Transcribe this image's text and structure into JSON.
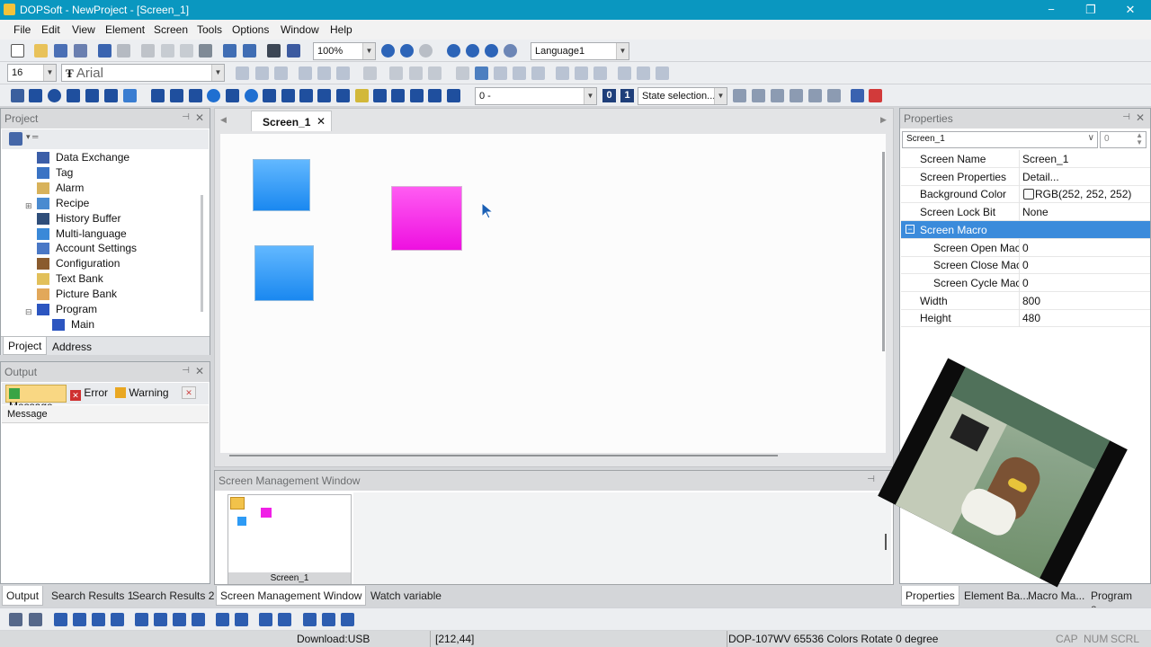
{
  "app": {
    "title": "DOPSoft - NewProject - [Screen_1]"
  },
  "window_controls": {
    "minimize": "−",
    "maximize": "❐",
    "close": "✕"
  },
  "menu": [
    "File",
    "Edit",
    "View",
    "Element",
    "Screen",
    "Tools",
    "Options",
    "Window",
    "Help"
  ],
  "toolbar": {
    "zoom": "100%",
    "language": "Language1",
    "font_size": "16",
    "font_name": "Arial",
    "state_value": "0 -",
    "state_0": "0",
    "state_1": "1",
    "state_selection": "State selection..."
  },
  "project_panel": {
    "title": "Project",
    "items": [
      {
        "label": "Data Exchange",
        "icon": "data-exchange-icon",
        "color": "#3b5ea8"
      },
      {
        "label": "Tag",
        "icon": "tag-icon",
        "color": "#3a73c4"
      },
      {
        "label": "Alarm",
        "icon": "alarm-icon",
        "color": "#d8b25a"
      },
      {
        "label": "Recipe",
        "icon": "recipe-icon",
        "color": "#4a8bd0"
      },
      {
        "label": "History Buffer",
        "icon": "history-buffer-icon",
        "color": "#2f4e7a"
      },
      {
        "label": "Multi-language",
        "icon": "globe-icon",
        "color": "#3a89d8"
      },
      {
        "label": "Account Settings",
        "icon": "account-icon",
        "color": "#4a78c6"
      },
      {
        "label": "Configuration",
        "icon": "configuration-icon",
        "color": "#8a5b2e"
      },
      {
        "label": "Text Bank",
        "icon": "text-bank-icon",
        "color": "#e2c05a"
      },
      {
        "label": "Picture Bank",
        "icon": "picture-bank-icon",
        "color": "#e2a85a"
      },
      {
        "label": "Program",
        "icon": "program-icon",
        "color": "#2c55c0"
      },
      {
        "label": "Main",
        "icon": "main-program-icon",
        "color": "#2c55c0"
      }
    ],
    "tabs": [
      "Project",
      "Address"
    ]
  },
  "output_panel": {
    "title": "Output",
    "filters": [
      "Message",
      "Error",
      "Warning"
    ],
    "column": "Message"
  },
  "document": {
    "tab": "Screen_1"
  },
  "canvas": {
    "shapes": [
      {
        "name": "blue-rect-1",
        "color": "#2e9bf5"
      },
      {
        "name": "blue-rect-2",
        "color": "#2e9bf5"
      },
      {
        "name": "magenta-rect",
        "color": "#f020e6"
      }
    ]
  },
  "screen_mgmt": {
    "title": "Screen Management Window",
    "thumb_label": "Screen_1"
  },
  "bottom_tabs": [
    "Output",
    "Search Results 1",
    "Search Results 2",
    "Screen Management Window",
    "Watch variable"
  ],
  "properties": {
    "title": "Properties",
    "selector": "Screen_1",
    "selector_num": "0",
    "rows": [
      {
        "name": "Screen Name",
        "value": "Screen_1"
      },
      {
        "name": "Screen Properties",
        "value": "Detail..."
      },
      {
        "name": "Background Color",
        "value": "RGB(252, 252, 252)"
      },
      {
        "name": "Screen Lock Bit",
        "value": "None"
      }
    ],
    "group": "Screen Macro",
    "macro_rows": [
      {
        "name": "Screen Open Mac",
        "value": "0"
      },
      {
        "name": "Screen Close Macr",
        "value": "0"
      },
      {
        "name": "Screen Cycle Macr",
        "value": "0"
      }
    ],
    "size_rows": [
      {
        "name": "Width",
        "value": "800"
      },
      {
        "name": "Height",
        "value": "480"
      }
    ],
    "tabs": [
      "Properties",
      "Element Ba...",
      "Macro Ma...",
      "Program e..."
    ]
  },
  "status": {
    "download": "Download:USB",
    "coords": "[212,44]",
    "device": "DOP-107WV 65536 Colors Rotate 0 degree",
    "caps": "CAP",
    "num": "NUM",
    "scrl": "SCRL"
  },
  "colors": {
    "titlebar": "#0a97c0",
    "selection": "#3b8bdb"
  }
}
